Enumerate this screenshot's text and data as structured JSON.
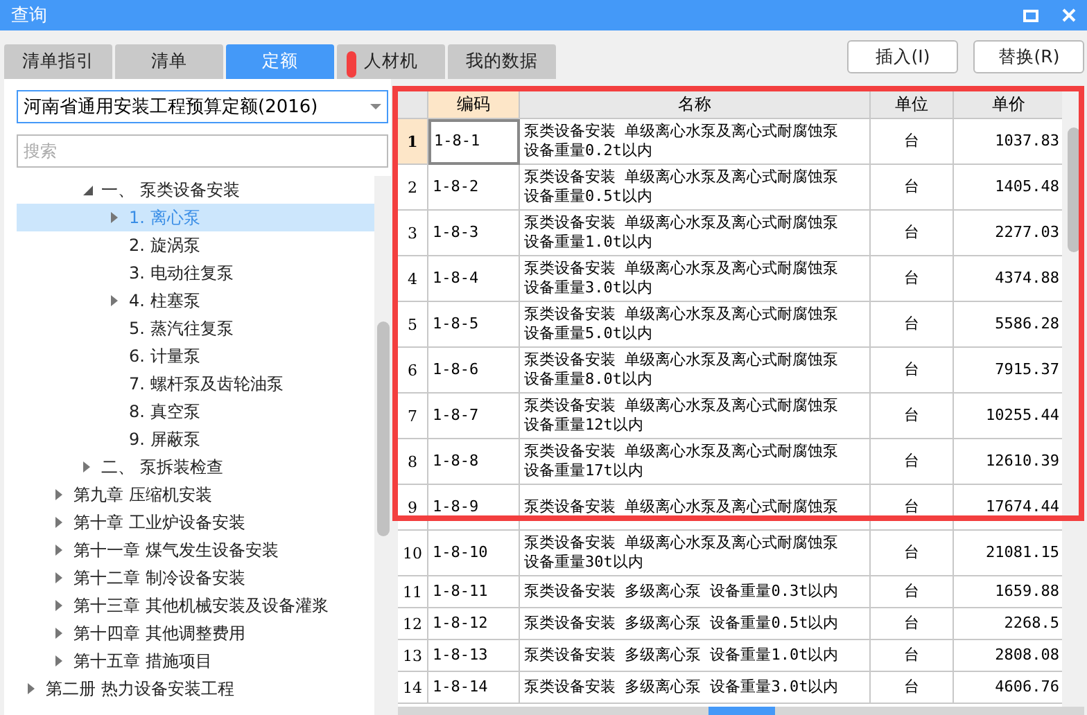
{
  "window": {
    "title": "查询"
  },
  "tabs": [
    {
      "label": "清单指引",
      "selected": false
    },
    {
      "label": "清单",
      "selected": false
    },
    {
      "label": "定额",
      "selected": true
    },
    {
      "label": "人材机",
      "selected": false
    },
    {
      "label": "我的数据",
      "selected": false
    }
  ],
  "library_select": {
    "value": "河南省通用安装工程预算定额(2016)"
  },
  "search": {
    "placeholder": "搜索"
  },
  "tree": [
    {
      "children": [
        {
          "children": [
            {
              "label": "一、 泵类设备安装",
              "selected": false,
              "expanded": true,
              "children": [
                {
                  "label": "1. 离心泵",
                  "selected": true,
                  "expanded": false
                },
                {
                  "label": "2. 旋涡泵",
                  "selected": false
                },
                {
                  "label": "3. 电动往复泵",
                  "selected": false
                },
                {
                  "label": "4. 柱塞泵",
                  "selected": false,
                  "expanded": false
                },
                {
                  "label": "5. 蒸汽往复泵",
                  "selected": false
                },
                {
                  "label": "6. 计量泵",
                  "selected": false
                },
                {
                  "label": "7. 螺杆泵及齿轮油泵",
                  "selected": false
                },
                {
                  "label": "8. 真空泵",
                  "selected": false
                },
                {
                  "label": "9. 屏蔽泵",
                  "selected": false
                }
              ]
            },
            {
              "label": "二、 泵拆装检查",
              "selected": false,
              "expanded": false
            }
          ]
        },
        {
          "label": "第九章 压缩机安装",
          "selected": false,
          "expanded": false
        },
        {
          "label": "第十章 工业炉设备安装",
          "selected": false,
          "expanded": false
        },
        {
          "label": "第十一章 煤气发生设备安装",
          "selected": false,
          "expanded": false
        },
        {
          "label": "第十二章 制冷设备安装",
          "selected": false,
          "expanded": false
        },
        {
          "label": "第十三章 其他机械安装及设备灌浆",
          "selected": false,
          "expanded": false
        },
        {
          "label": "第十四章 其他调整费用",
          "selected": false,
          "expanded": false
        },
        {
          "label": "第十五章 措施项目",
          "selected": false,
          "expanded": false
        }
      ]
    },
    {
      "label": "第二册 热力设备安装工程",
      "selected": false,
      "expanded": false
    }
  ],
  "buttons": [
    {
      "label": "插入(I)"
    },
    {
      "label": "替换(R)"
    }
  ],
  "table": {
    "columns": [
      "编码",
      "名称",
      "单位",
      "单价"
    ],
    "rows": [
      {
        "index": "1",
        "code": "1-8-1",
        "name": "泵类设备安装 单级离心水泵及离心式耐腐蚀泵设备重量0.2t以内",
        "unit": "台",
        "price": "1037.83",
        "selected": true
      },
      {
        "index": "2",
        "code": "1-8-2",
        "name": "泵类设备安装 单级离心水泵及离心式耐腐蚀泵设备重量0.5t以内",
        "unit": "台",
        "price": "1405.48",
        "selected": false
      },
      {
        "index": "3",
        "code": "1-8-3",
        "name": "泵类设备安装 单级离心水泵及离心式耐腐蚀泵设备重量1.0t以内",
        "unit": "台",
        "price": "2277.03",
        "selected": false
      },
      {
        "index": "4",
        "code": "1-8-4",
        "name": "泵类设备安装 单级离心水泵及离心式耐腐蚀泵设备重量3.0t以内",
        "unit": "台",
        "price": "4374.88",
        "selected": false
      },
      {
        "index": "5",
        "code": "1-8-5",
        "name": "泵类设备安装 单级离心水泵及离心式耐腐蚀泵设备重量5.0t以内",
        "unit": "台",
        "price": "5586.28",
        "selected": false
      },
      {
        "index": "6",
        "code": "1-8-6",
        "name": "泵类设备安装 单级离心水泵及离心式耐腐蚀泵设备重量8.0t以内",
        "unit": "台",
        "price": "7915.37",
        "selected": false
      },
      {
        "index": "7",
        "code": "1-8-7",
        "name": "泵类设备安装 单级离心水泵及离心式耐腐蚀泵设备重量12t以内",
        "unit": "台",
        "price": "10255.44",
        "selected": false
      },
      {
        "index": "8",
        "code": "1-8-8",
        "name": "泵类设备安装 单级离心水泵及离心式耐腐蚀泵设备重量17t以内",
        "unit": "台",
        "price": "12610.39",
        "selected": false
      },
      {
        "index": "9",
        "code": "1-8-9",
        "name": "泵类设备安装 单级离心水泵及离心式耐腐蚀泵",
        "unit": "台",
        "price": "17674.44",
        "selected": false
      },
      {
        "index": "10",
        "code": "1-8-10",
        "name": "泵类设备安装 单级离心水泵及离心式耐腐蚀泵设备重量30t以内",
        "unit": "台",
        "price": "21081.15",
        "selected": false
      },
      {
        "index": "11",
        "code": "1-8-11",
        "name": "泵类设备安装 多级离心泵 设备重量0.3t以内",
        "unit": "台",
        "price": "1659.88",
        "selected": false
      },
      {
        "index": "12",
        "code": "1-8-12",
        "name": "泵类设备安装 多级离心泵 设备重量0.5t以内",
        "unit": "台",
        "price": "2268.5",
        "selected": false
      },
      {
        "index": "13",
        "code": "1-8-13",
        "name": "泵类设备安装 多级离心泵 设备重量1.0t以内",
        "unit": "台",
        "price": "2808.08",
        "selected": false
      },
      {
        "index": "14",
        "code": "1-8-14",
        "name": "泵类设备安装 多级离心泵 设备重量3.0t以内",
        "unit": "台",
        "price": "4606.76",
        "selected": false
      }
    ]
  }
}
